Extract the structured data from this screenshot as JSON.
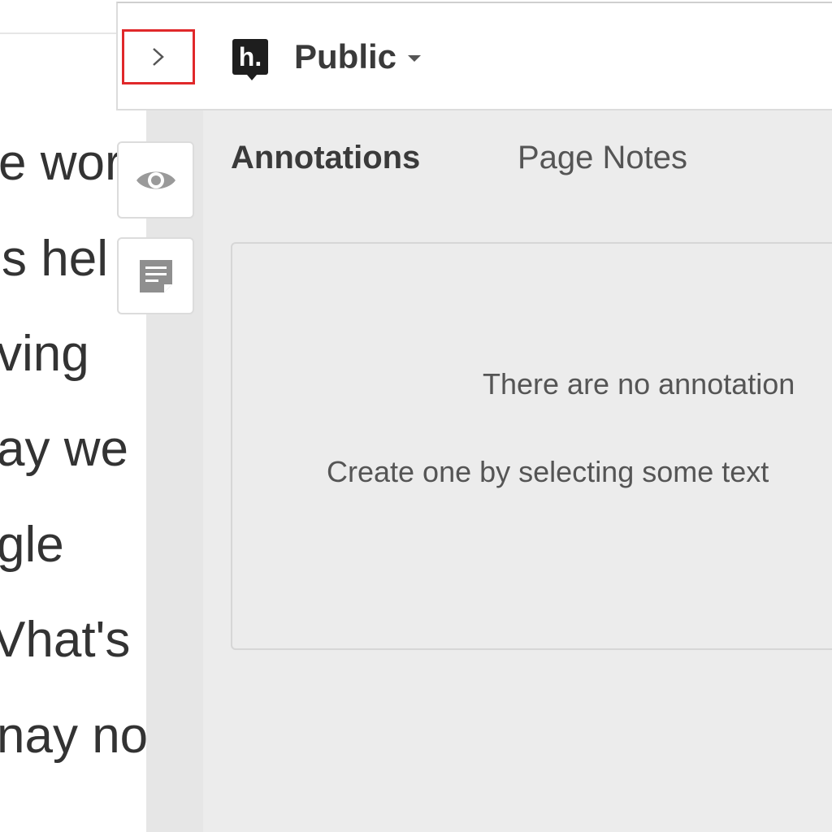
{
  "background_page": {
    "lines": [
      "e worl",
      "s hel",
      "ving",
      "ay we",
      "gle",
      "Vhat's",
      "nay not"
    ]
  },
  "header": {
    "toggle_icon": "chevron-right-icon",
    "logo_text": "h.",
    "group_label": "Public"
  },
  "controls": {
    "eye_icon": "eye-icon",
    "note_icon": "page-note-icon"
  },
  "tabs": [
    {
      "label": "Annotations",
      "active": true
    },
    {
      "label": "Page Notes",
      "active": false
    }
  ],
  "empty_state": {
    "message": "There are no annotation",
    "hint": "Create one by selecting some text"
  },
  "colors": {
    "highlight_border": "#e0282a",
    "sidebar_bg": "#ececec",
    "text_dark": "#3a3a3a"
  }
}
